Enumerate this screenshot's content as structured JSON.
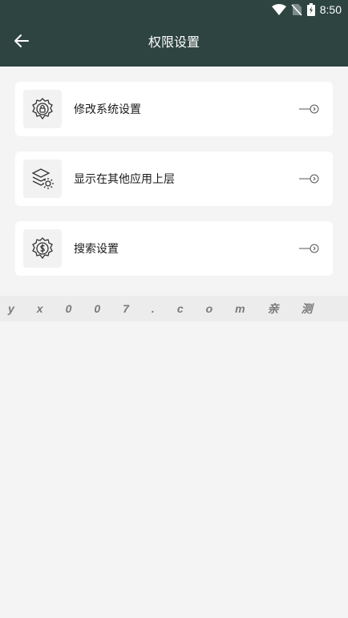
{
  "status_bar": {
    "time": "8:50",
    "icons": [
      "wifi-icon",
      "no-sim-icon",
      "battery-charging-icon"
    ]
  },
  "header": {
    "title": "权限设置",
    "back_icon": "arrow-left-icon"
  },
  "settings": [
    {
      "label": "修改系统设置",
      "icon": "gear-lock-icon"
    },
    {
      "label": "显示在其他应用上层",
      "icon": "layers-gear-icon"
    },
    {
      "label": "搜索设置",
      "icon": "globe-gear-icon"
    }
  ],
  "watermark": "yx007.com亲测",
  "colors": {
    "header_bg": "#2e4440",
    "page_bg": "#f4f4f4",
    "card_bg": "#ffffff"
  }
}
